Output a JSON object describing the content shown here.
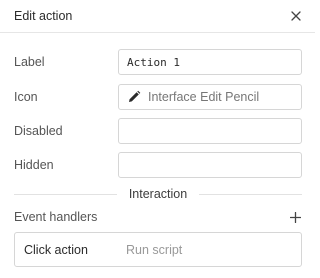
{
  "header": {
    "title": "Edit action"
  },
  "fields": {
    "label": {
      "label": "Label",
      "value": "Action 1"
    },
    "icon": {
      "label": "Icon",
      "value": "Interface Edit Pencil",
      "icon": "pencil-icon"
    },
    "disabled": {
      "label": "Disabled",
      "value": ""
    },
    "hidden": {
      "label": "Hidden",
      "value": ""
    }
  },
  "interaction": {
    "section_title": "Interaction",
    "event_handlers_label": "Event handlers",
    "handlers": [
      {
        "event": "Click action",
        "action": "Run script"
      }
    ]
  }
}
